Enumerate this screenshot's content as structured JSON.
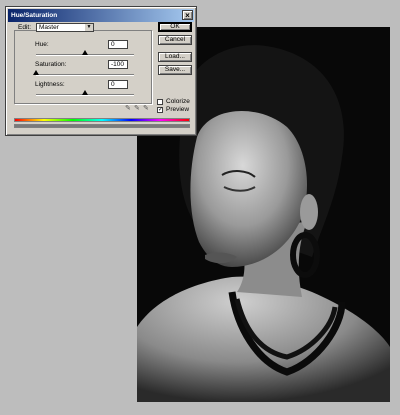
{
  "dialog": {
    "title": "Hue/Saturation",
    "edit_label": "Edit:",
    "edit_value": "Master",
    "hue_label": "Hue:",
    "hue_value": "0",
    "hue_level": 0.5,
    "saturation_label": "Saturation:",
    "saturation_value": "-100",
    "saturation_level": 0.0,
    "lightness_label": "Lightness:",
    "lightness_value": "0",
    "lightness_level": 0.5,
    "buttons": {
      "ok": "OK",
      "cancel": "Cancel",
      "load": "Load...",
      "save": "Save..."
    },
    "colorize_label": "Colorize",
    "colorize_checked": false,
    "preview_label": "Preview",
    "preview_checked": true,
    "icons": [
      "eyedropper-icon",
      "eyedropper-plus-icon",
      "eyedropper-minus-icon"
    ]
  },
  "colors": {
    "dialog_bg": "#d4d0c8",
    "title_start": "#0a246a",
    "title_end": "#a6caf0",
    "canvas_bg": "#bdbdbd",
    "photo_bg": "#080808"
  }
}
